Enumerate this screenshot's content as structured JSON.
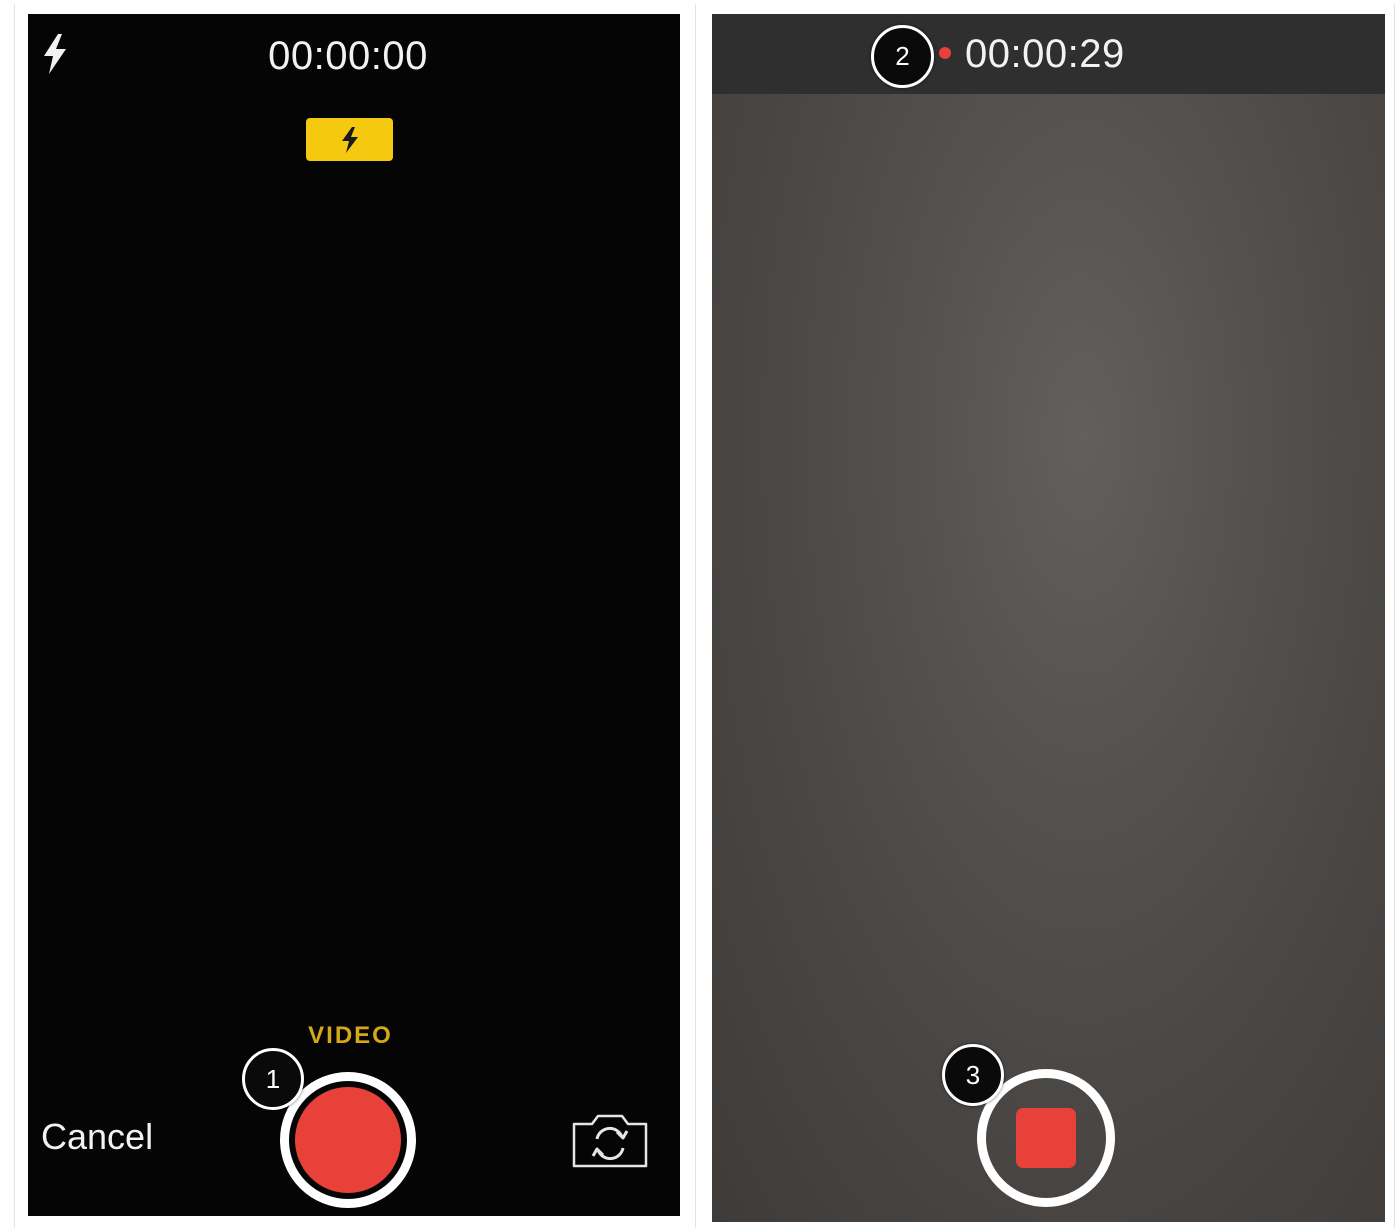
{
  "left_screen": {
    "timer": "00:00:00",
    "mode_label": "VIDEO",
    "cancel_label": "Cancel",
    "flash_icon": "flash-icon",
    "flash_badge_icon": "flash-on-icon",
    "record_button_icon": "record-icon",
    "switch_camera_icon": "switch-camera-icon"
  },
  "right_screen": {
    "timer": "00:00:29",
    "recording_indicator_icon": "recording-dot-icon",
    "stop_button_icon": "stop-icon"
  },
  "callouts": [
    "1",
    "2",
    "3"
  ],
  "colors": {
    "record_red": "#e8413a",
    "flash_yellow": "#f4c90f",
    "mode_gold": "#d5a818"
  }
}
